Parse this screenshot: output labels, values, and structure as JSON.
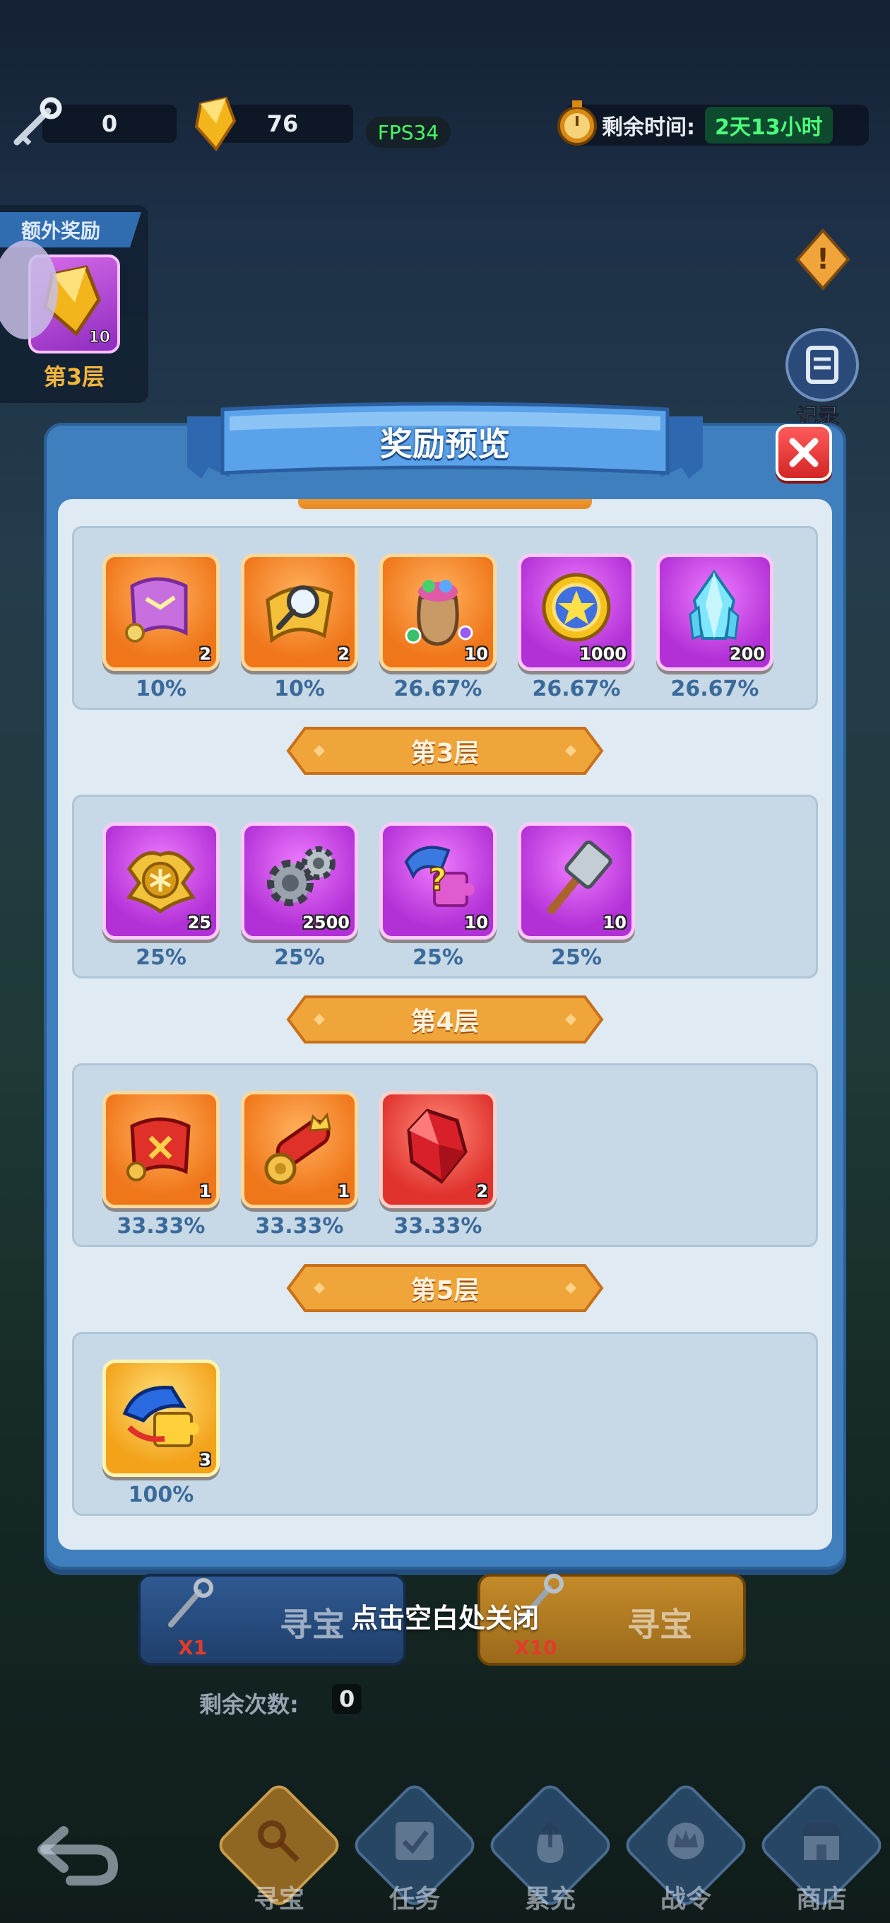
{
  "hud": {
    "keys_count": "0",
    "gems_count": "76",
    "fps": "FPS34",
    "time_label": "剩余时间:",
    "time_value": "2天13小时"
  },
  "bonus": {
    "title": "额外奖励",
    "item_qty": "10",
    "level": "第3层"
  },
  "side": {
    "record_label": "记录"
  },
  "modal": {
    "title": "奖励预览",
    "tiers": [
      {
        "header": "",
        "items": [
          {
            "icon": "purple-scroll-icon",
            "qty": "2",
            "pct": "10%",
            "bg": "orange"
          },
          {
            "icon": "magnifier-map-icon",
            "qty": "2",
            "pct": "10%",
            "bg": "orange"
          },
          {
            "icon": "treasure-bag-icon",
            "qty": "10",
            "pct": "26.67%",
            "bg": "orange"
          },
          {
            "icon": "gold-star-medal-icon",
            "qty": "1000",
            "pct": "26.67%",
            "bg": "purple"
          },
          {
            "icon": "blue-crystal-icon",
            "qty": "200",
            "pct": "26.67%",
            "bg": "purple"
          }
        ]
      },
      {
        "header": "第3层",
        "items": [
          {
            "icon": "gold-badge-icon",
            "qty": "25",
            "pct": "25%",
            "bg": "purple"
          },
          {
            "icon": "gears-icon",
            "qty": "2500",
            "pct": "25%",
            "bg": "purple"
          },
          {
            "icon": "mystery-puzzle-icon",
            "qty": "10",
            "pct": "25%",
            "bg": "purple"
          },
          {
            "icon": "hammer-icon",
            "qty": "10",
            "pct": "25%",
            "bg": "purple"
          }
        ]
      },
      {
        "header": "第4层",
        "items": [
          {
            "icon": "red-scroll-icon",
            "qty": "1",
            "pct": "33.33%",
            "bg": "orange"
          },
          {
            "icon": "rolled-scroll-icon",
            "qty": "1",
            "pct": "33.33%",
            "bg": "orange"
          },
          {
            "icon": "red-gem-icon",
            "qty": "2",
            "pct": "33.33%",
            "bg": "red"
          }
        ]
      },
      {
        "header": "第5层",
        "items": [
          {
            "icon": "hat-puzzle-icon",
            "qty": "3",
            "pct": "100%",
            "bg": "gold"
          }
        ]
      }
    ]
  },
  "bottom": {
    "close_hint": "点击空白处关闭",
    "hunt_x1_label": "寻宝",
    "hunt_x1_cost": "X1",
    "hunt_x10_label": "寻宝",
    "hunt_x10_cost": "X10",
    "remaining_label": "剩余次数:",
    "remaining_value": "0"
  },
  "tabs": [
    "寻宝",
    "任务",
    "累充",
    "战令",
    "商店"
  ],
  "colors": {
    "accent_blue": "#3f7fbd",
    "tier_orange": "#f0a53a",
    "pct_text": "#3a6a9a",
    "close_red": "#d42525"
  }
}
